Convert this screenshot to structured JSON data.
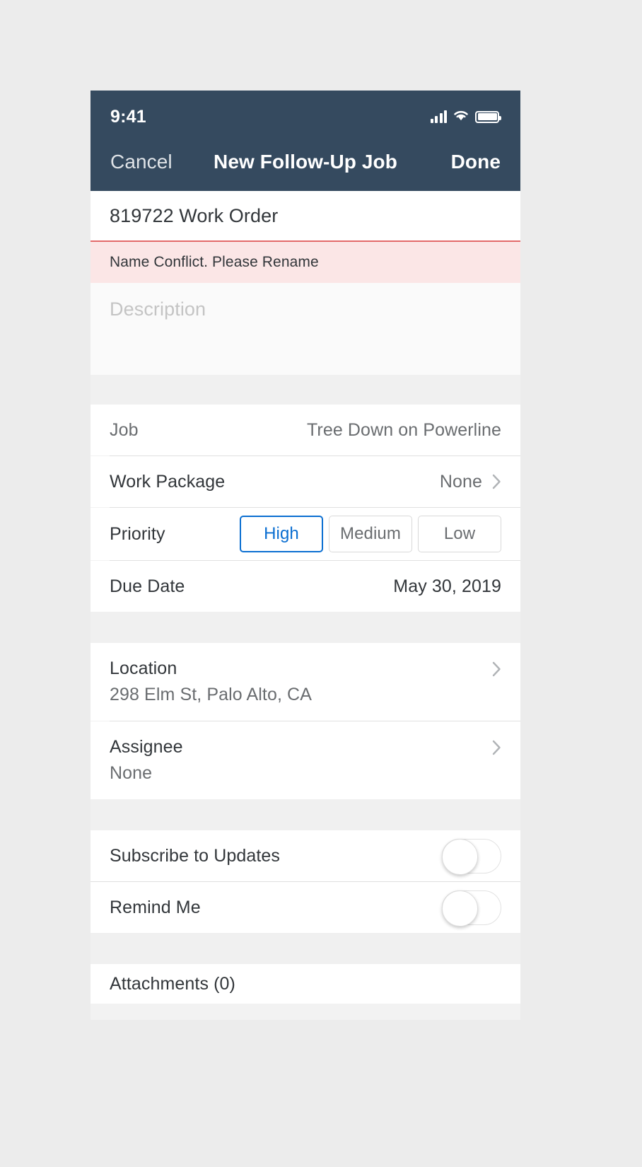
{
  "status_bar": {
    "time": "9:41",
    "cellular_icon": "signal-bars-icon",
    "wifi_icon": "wifi-icon",
    "battery_icon": "battery-full-icon"
  },
  "navbar": {
    "cancel_label": "Cancel",
    "title": "New Follow-Up Job",
    "done_label": "Done"
  },
  "form": {
    "title_field": {
      "value": "819722 Work Order",
      "error_message": "Name Conflict. Please Rename",
      "error_color": "#e36969",
      "error_background": "#fbe6e6"
    },
    "description_field": {
      "value": "",
      "placeholder": "Description"
    },
    "job_row": {
      "label": "Job",
      "value": "Tree Down on Powerline"
    },
    "work_package_row": {
      "label": "Work Package",
      "value": "None",
      "chevron_icon": "chevron-right-icon"
    },
    "priority_row": {
      "label": "Priority",
      "options": [
        {
          "label": "High",
          "selected": true
        },
        {
          "label": "Medium",
          "selected": false
        },
        {
          "label": "Low",
          "selected": false
        }
      ],
      "selected_color": "#0a6ed1"
    },
    "due_date_row": {
      "label": "Due Date",
      "value": "May 30, 2019"
    },
    "location_row": {
      "label": "Location",
      "value": "298 Elm St, Palo Alto, CA",
      "chevron_icon": "chevron-right-icon"
    },
    "assignee_row": {
      "label": "Assignee",
      "value": "None",
      "chevron_icon": "chevron-right-icon"
    },
    "subscribe_row": {
      "label": "Subscribe to Updates",
      "state": "off"
    },
    "remind_row": {
      "label": "Remind Me",
      "state": "off"
    },
    "attachments_row": {
      "label": "Attachments (0)"
    }
  },
  "theme": {
    "header_background": "#354a5f",
    "page_background": "#ececec",
    "row_background": "#ffffff",
    "group_gap": "#f0f0f0"
  }
}
